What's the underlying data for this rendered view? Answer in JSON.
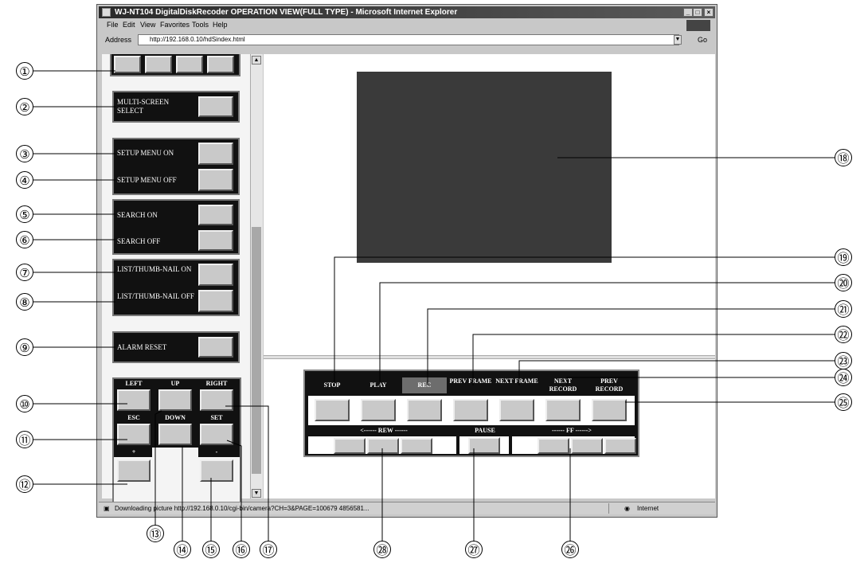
{
  "window": {
    "title": "WJ-NT104 DigitalDiskRecoder OPERATION VIEW(FULL TYPE) - Microsoft Internet Explorer",
    "menu": [
      "File",
      "Edit",
      "View",
      "Favorites",
      "Tools",
      "Help"
    ],
    "address_label": "Address",
    "address_value": "http://192.168.0.10/hdSindex.html",
    "go_label": "Go",
    "status_text": "Downloading picture http://192.168.0.10/cgi-bin/camera?CH=3&PAGE=100679 4856581...",
    "zone_label": "Internet"
  },
  "left_panel": {
    "multi_screen_select": "MULTI-SCREEN SELECT",
    "setup_menu_on": "SETUP MENU ON",
    "setup_menu_off": "SETUP MENU OFF",
    "search_on": "SEARCH ON",
    "search_off": "SEARCH OFF",
    "list_thumbnail_on": "LIST/THUMB-NAIL ON",
    "list_thumbnail_off": "LIST/THUMB-NAIL OFF",
    "alarm_reset": "ALARM RESET",
    "left": "LEFT",
    "up": "UP",
    "right": "RIGHT",
    "esc": "ESC",
    "down": "DOWN",
    "set": "SET",
    "plus": "+",
    "minus": "-"
  },
  "controls": {
    "stop": "STOP",
    "play": "PLAY",
    "rec": "REC",
    "prev_frame": "PREV FRAME",
    "next_frame": "NEXT FRAME",
    "next_record": "NEXT RECORD",
    "prev_record": "PREV RECORD",
    "rew": "<------ REW ------",
    "pause": "PAUSE",
    "ff": "------ FF ------>"
  },
  "callouts": [
    "①",
    "②",
    "③",
    "④",
    "⑤",
    "⑥",
    "⑦",
    "⑧",
    "⑨",
    "⑩",
    "⑪",
    "⑫",
    "⑬",
    "⑭",
    "⑮",
    "⑯",
    "⑰",
    "⑱",
    "⑲",
    "⑳",
    "㉑",
    "㉒",
    "㉓",
    "㉔",
    "㉕",
    "㉖",
    "㉗",
    "㉘"
  ]
}
